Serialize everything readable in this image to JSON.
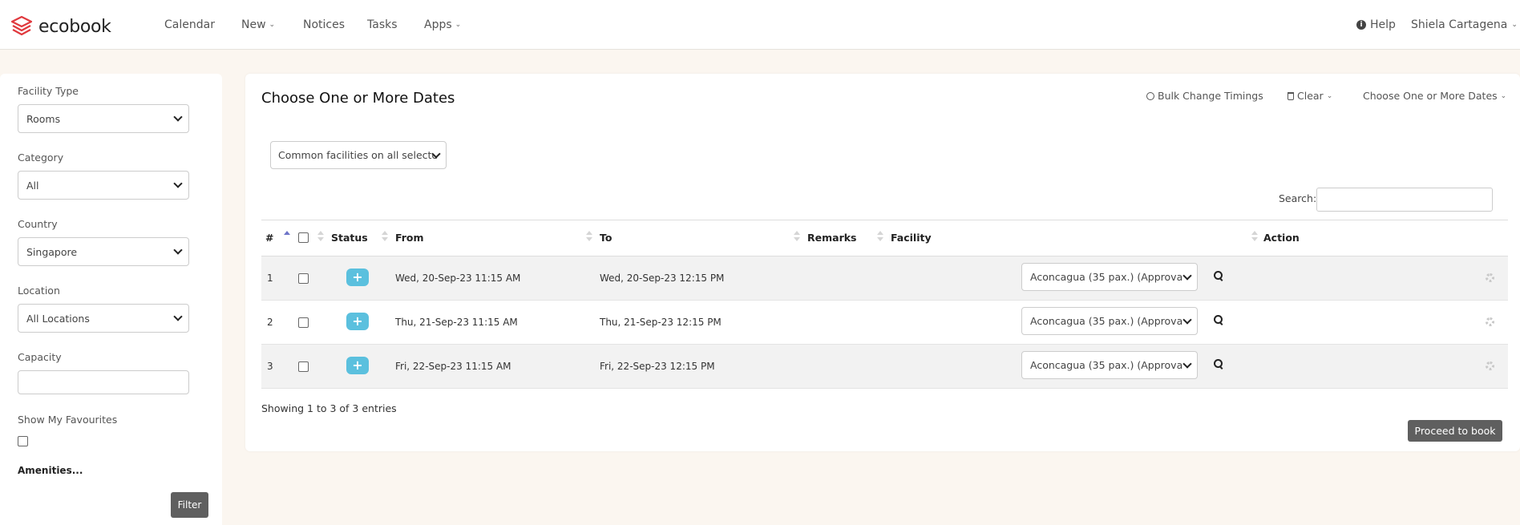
{
  "nav": {
    "brand": "ecobook",
    "items": [
      "Calendar",
      "New",
      "Notices",
      "Tasks",
      "Apps"
    ],
    "help": "Help",
    "user": "Shiela Cartagena",
    "accent": "#e0393e"
  },
  "filters": {
    "facility_type_label": "Facility Type",
    "facility_type_value": "Rooms",
    "category_label": "Category",
    "category_value": "All",
    "country_label": "Country",
    "country_value": "Singapore",
    "location_label": "Location",
    "location_value": "All Locations",
    "capacity_label": "Capacity",
    "favourites_label": "Show My Favourites",
    "amenities": "Amenities...",
    "filter_button": "Filter"
  },
  "main": {
    "title": "Choose One or More Dates",
    "bulk_change": "Bulk Change Timings",
    "clear": "Clear",
    "choose_dates": "Choose One or More Dates",
    "common_facilities": "Common facilities on all selecte",
    "search_label": "Search:",
    "columns": [
      "#",
      "Status",
      "From",
      "To",
      "Remarks",
      "Facility",
      "Action"
    ],
    "rows": [
      {
        "num": "1",
        "from": "Wed, 20-Sep-23 11:15 AM",
        "to": "Wed, 20-Sep-23 12:15 PM",
        "facility": "Aconcagua (35 pax.) (Approva"
      },
      {
        "num": "2",
        "from": "Thu, 21-Sep-23 11:15 AM",
        "to": "Thu, 21-Sep-23 12:15 PM",
        "facility": "Aconcagua (35 pax.) (Approva"
      },
      {
        "num": "3",
        "from": "Fri, 22-Sep-23 11:15 AM",
        "to": "Fri, 22-Sep-23 12:15 PM",
        "facility": "Aconcagua (35 pax.) (Approva"
      }
    ],
    "status_symbol": "+",
    "showing": "Showing 1 to 3 of 3 entries",
    "proceed": "Proceed to book",
    "status_color": "#5bc0de"
  }
}
